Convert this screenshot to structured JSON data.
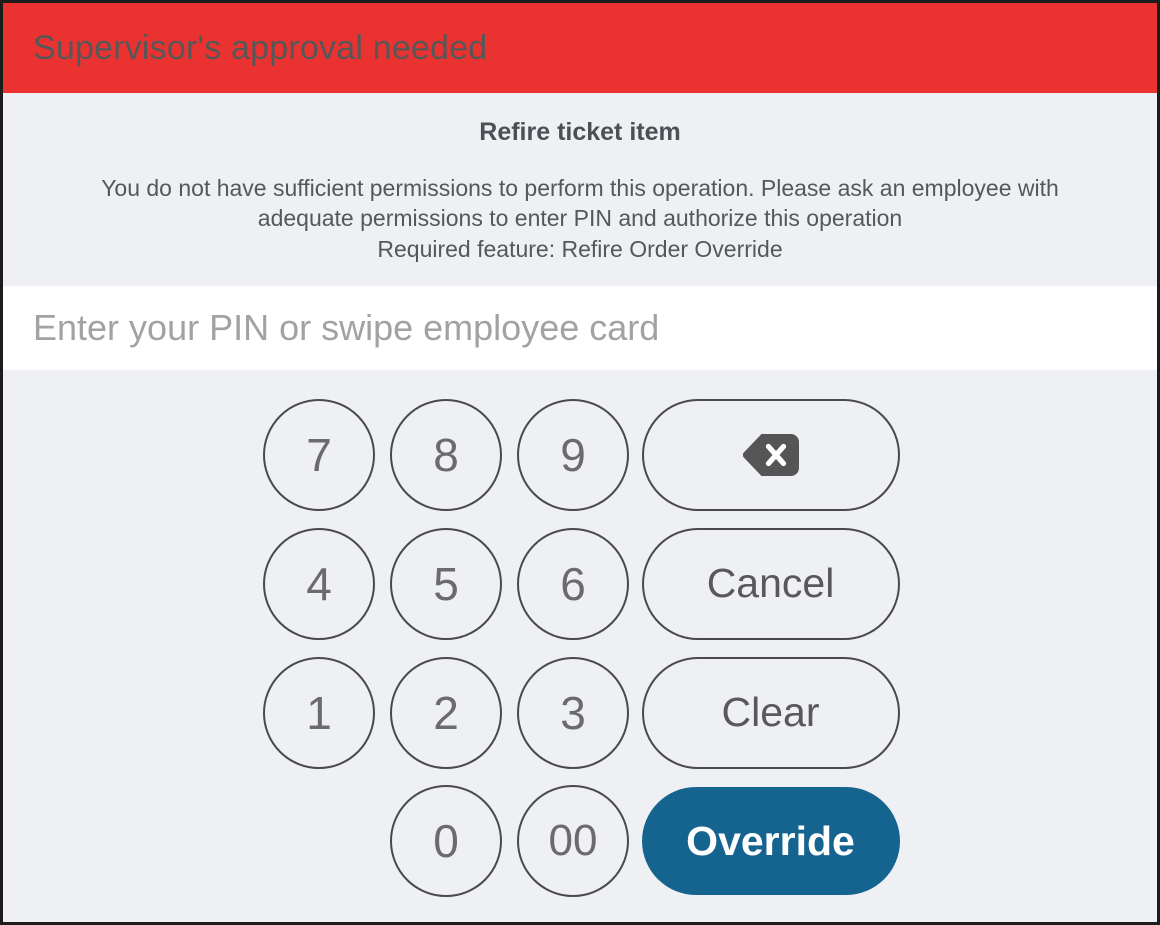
{
  "header": {
    "title": "Supervisor's approval needed",
    "background_color": "#ea3331",
    "text_color": "#575757"
  },
  "message": {
    "operation_title": "Refire ticket item",
    "lines": [
      "You do not have sufficient permissions to perform this operation. Please ask an employee with",
      "adequate permissions to enter PIN and authorize this operation",
      "Required feature: Refire Order Override"
    ]
  },
  "pin_field": {
    "value": "",
    "placeholder": "Enter your PIN or swipe employee card"
  },
  "keypad": {
    "digits": {
      "d7": "7",
      "d8": "8",
      "d9": "9",
      "d4": "4",
      "d5": "5",
      "d6": "6",
      "d1": "1",
      "d2": "2",
      "d3": "3",
      "d0": "0",
      "d00": "00"
    },
    "backspace_icon": "backspace-icon",
    "cancel_label": "Cancel",
    "clear_label": "Clear",
    "override_label": "Override"
  },
  "colors": {
    "background": "#eef0f3",
    "accent_red": "#ea3331",
    "accent_blue": "#14648f",
    "outline_gray": "#4a4a4a",
    "digit_gray": "#6b6b6b",
    "placeholder_gray": "#a2a2a2",
    "icon_gray": "#555555"
  }
}
